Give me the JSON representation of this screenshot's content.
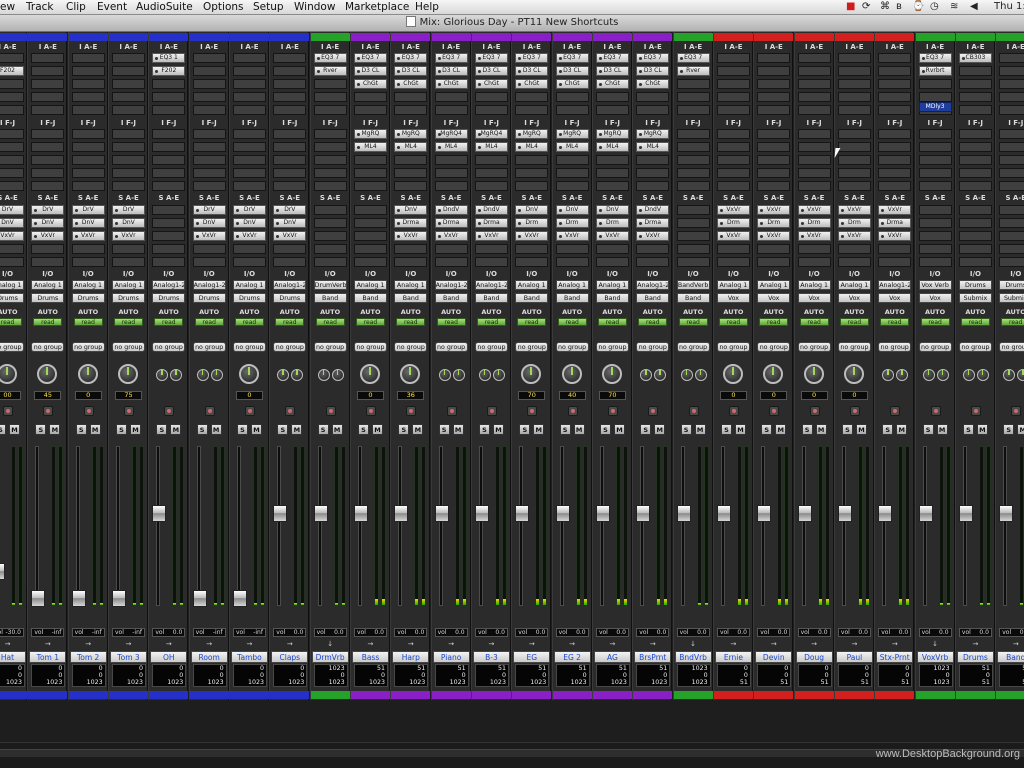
{
  "menubar": {
    "items": [
      "ew",
      "Track",
      "Clip",
      "Event",
      "AudioSuite",
      "Options",
      "Setup",
      "Window",
      "Marketplace",
      "Help"
    ],
    "clock": "Thu 1:"
  },
  "titlebar": {
    "title": "Mix: Glorious Day - PT11 New Shortcuts"
  },
  "section_labels": {
    "inserts_a": "I A-E",
    "inserts_f": "I F-J",
    "sends": "S A-E",
    "io": "I/O",
    "auto": "AUTO",
    "read": "read",
    "vol": "vol"
  },
  "colors": {
    "blue": "#2430c8",
    "green": "#25a22a",
    "purple": "#8a1fc8",
    "red": "#d41f1f",
    "record": "#d06a6a"
  },
  "tracks": [
    {
      "name": "Hat",
      "color": "blue",
      "inserts_a": [
        "",
        "F202"
      ],
      "inserts_f": [],
      "sends": [
        "DrV",
        "DnV",
        "VxVr"
      ],
      "io": [
        "Analog 1",
        "Drums"
      ],
      "pan": "00",
      "vol": "-30.0",
      "fader": 0.22,
      "nums": [
        "0",
        "0",
        "1023"
      ]
    },
    {
      "name": "Tom 1",
      "color": "blue",
      "inserts_a": [],
      "inserts_f": [],
      "sends": [
        "DrV",
        "DnV",
        "VxVr"
      ],
      "io": [
        "Analog 1",
        "Drums"
      ],
      "pan": "45",
      "vol": "-inf",
      "fader": 0.05,
      "nums": [
        "0",
        "0",
        "1023"
      ]
    },
    {
      "name": "Tom 2",
      "color": "blue",
      "inserts_a": [],
      "inserts_f": [],
      "sends": [
        "DrV",
        "DnV",
        "VxVr"
      ],
      "io": [
        "Analog 1",
        "Drums"
      ],
      "pan": "0",
      "vol": "-inf",
      "fader": 0.05,
      "nums": [
        "0",
        "0",
        "1023"
      ]
    },
    {
      "name": "Tom 3",
      "color": "blue",
      "inserts_a": [],
      "inserts_f": [],
      "sends": [
        "DrV",
        "DnV",
        "VxVr"
      ],
      "io": [
        "Analog 1",
        "Drums"
      ],
      "pan": "75",
      "vol": "-inf",
      "fader": 0.05,
      "nums": [
        "0",
        "0",
        "1023"
      ]
    },
    {
      "name": "OH",
      "color": "blue",
      "inserts_a": [
        "EQ3 1",
        "F202"
      ],
      "inserts_f": [],
      "sends": [],
      "io": [
        "Analog1-2",
        "Drums"
      ],
      "pan": "",
      "vol": "0.0",
      "fader": 0.58,
      "nums": [
        "0",
        "0",
        "1023"
      ]
    },
    {
      "name": "Room",
      "color": "blue",
      "inserts_a": [],
      "inserts_f": [],
      "sends": [
        "DrV",
        "DnV",
        "VxVr"
      ],
      "io": [
        "Analog1-2",
        "Drums"
      ],
      "pan": "",
      "vol": "-inf",
      "fader": 0.05,
      "nums": [
        "0",
        "0",
        "1023"
      ]
    },
    {
      "name": "Tambo",
      "color": "blue",
      "inserts_a": [],
      "inserts_f": [],
      "sends": [
        "DrV",
        "DnV",
        "VxVr"
      ],
      "io": [
        "Analog 1",
        "Drums"
      ],
      "pan": "0",
      "vol": "-inf",
      "fader": 0.05,
      "nums": [
        "0",
        "0",
        "1023"
      ]
    },
    {
      "name": "Claps",
      "color": "blue",
      "inserts_a": [],
      "inserts_f": [],
      "sends": [
        "DrV",
        "DnV",
        "VxVr"
      ],
      "io": [
        "Analog1-2",
        "Drums"
      ],
      "pan": "",
      "vol": "0.0",
      "fader": 0.58,
      "nums": [
        "0",
        "0",
        "1023"
      ]
    },
    {
      "name": "DrmVrb",
      "color": "green",
      "inserts_a": [
        "EQ3 7",
        "Rver"
      ],
      "inserts_f": [],
      "sends": [],
      "io": [
        "DrumVerb",
        "Band"
      ],
      "pan": "",
      "vol": "0.0",
      "fader": 0.58,
      "nums": [
        "1023",
        "0",
        "1023"
      ]
    },
    {
      "name": "Bass",
      "color": "purple",
      "inserts_a": [
        "EQ3 7",
        "D3 CL",
        "ChGt"
      ],
      "inserts_f": [
        "MgRQ",
        "ML4"
      ],
      "sends": [],
      "io": [
        "Analog 1",
        "Band"
      ],
      "pan": "0",
      "vol": "0.0",
      "fader": 0.58,
      "nums": [
        "51",
        "0",
        "1023"
      ]
    },
    {
      "name": "Harp",
      "color": "purple",
      "inserts_a": [
        "EQ3 7",
        "D3 CL",
        "ChGt"
      ],
      "inserts_f": [
        "MgRQ",
        "ML4"
      ],
      "sends": [
        "DnV",
        "Drma",
        "VxVr"
      ],
      "io": [
        "Analog 1",
        "Band"
      ],
      "pan": "36",
      "vol": "0.0",
      "fader": 0.58,
      "nums": [
        "51",
        "0",
        "1023"
      ]
    },
    {
      "name": "Piano",
      "color": "purple",
      "inserts_a": [
        "EQ3 7",
        "D3 CL",
        "ChGt"
      ],
      "inserts_f": [
        "MgRQ4",
        "ML4"
      ],
      "sends": [
        "DndV",
        "Drma",
        "VxVr"
      ],
      "io": [
        "Analog1-2",
        "Band"
      ],
      "pan": "",
      "vol": "0.0",
      "fader": 0.58,
      "nums": [
        "51",
        "0",
        "1023"
      ]
    },
    {
      "name": "B-3",
      "color": "purple",
      "inserts_a": [
        "EQ3 7",
        "D3 CL",
        "ChGt"
      ],
      "inserts_f": [
        "MgRQ4",
        "ML4"
      ],
      "sends": [
        "DndV",
        "Drma",
        "VxVr"
      ],
      "io": [
        "Analog1-2",
        "Band"
      ],
      "pan": "",
      "vol": "0.0",
      "fader": 0.58,
      "nums": [
        "51",
        "0",
        "1023"
      ]
    },
    {
      "name": "EG",
      "color": "purple",
      "inserts_a": [
        "EQ3 7",
        "D3 CL",
        "ChGt"
      ],
      "inserts_f": [
        "MgRQ",
        "ML4"
      ],
      "sends": [
        "DnV",
        "Drm",
        "VxVr"
      ],
      "io": [
        "Analog 1",
        "Band"
      ],
      "pan": "70",
      "vol": "0.0",
      "fader": 0.58,
      "nums": [
        "51",
        "0",
        "1023"
      ]
    },
    {
      "name": "EG 2",
      "color": "purple",
      "inserts_a": [
        "EQ3 7",
        "D3 CL",
        "ChGt"
      ],
      "inserts_f": [
        "MgRQ",
        "ML4"
      ],
      "sends": [
        "DnV",
        "Drm",
        "VxVr"
      ],
      "io": [
        "Analog 1",
        "Band"
      ],
      "pan": "40",
      "vol": "0.0",
      "fader": 0.58,
      "nums": [
        "51",
        "0",
        "1023"
      ]
    },
    {
      "name": "AG",
      "color": "purple",
      "inserts_a": [
        "EQ3 7",
        "D3 CL",
        "ChGt"
      ],
      "inserts_f": [
        "MgRQ",
        "ML4"
      ],
      "sends": [
        "DnV",
        "Drm",
        "VxVr"
      ],
      "io": [
        "Analog 1",
        "Band"
      ],
      "pan": "70",
      "vol": "0.0",
      "fader": 0.58,
      "nums": [
        "51",
        "0",
        "1023"
      ]
    },
    {
      "name": "BrsPrnt",
      "color": "purple",
      "inserts_a": [
        "EQ3 7",
        "D3 CL",
        "ChGt"
      ],
      "inserts_f": [
        "MgRQ",
        "ML4"
      ],
      "sends": [
        "DndV",
        "Drma",
        "VxVr"
      ],
      "io": [
        "Analog1-2",
        "Band"
      ],
      "pan": "",
      "vol": "0.0",
      "fader": 0.58,
      "nums": [
        "51",
        "0",
        "1023"
      ]
    },
    {
      "name": "BndVrb",
      "color": "green",
      "inserts_a": [
        "EQ3 7",
        "Rver"
      ],
      "inserts_f": [],
      "sends": [],
      "io": [
        "BandVerb",
        "Band"
      ],
      "pan": "",
      "vol": "0.0",
      "fader": 0.58,
      "nums": [
        "1023",
        "0",
        "1023"
      ]
    },
    {
      "name": "Ernie",
      "color": "red",
      "inserts_a": [],
      "inserts_f": [],
      "sends": [
        "VxVr",
        "Drm",
        "VxVr"
      ],
      "io": [
        "Analog 1",
        "Vox"
      ],
      "pan": "0",
      "vol": "0.0",
      "fader": 0.58,
      "nums": [
        "0",
        "0",
        "51"
      ]
    },
    {
      "name": "Devin",
      "color": "red",
      "inserts_a": [],
      "inserts_f": [],
      "sends": [
        "VxVr",
        "Drm",
        "VxVr"
      ],
      "io": [
        "Analog 1",
        "Vox"
      ],
      "pan": "0",
      "vol": "0.0",
      "fader": 0.58,
      "nums": [
        "0",
        "0",
        "51"
      ]
    },
    {
      "name": "Doug",
      "color": "red",
      "inserts_a": [],
      "inserts_f": [],
      "sends": [
        "VxVr",
        "Drm",
        "VxVr"
      ],
      "io": [
        "Analog 1",
        "Vox"
      ],
      "pan": "0",
      "vol": "0.0",
      "fader": 0.58,
      "nums": [
        "0",
        "0",
        "51"
      ]
    },
    {
      "name": "Paul",
      "color": "red",
      "inserts_a": [],
      "inserts_f": [],
      "sends": [
        "VxVr",
        "Drm",
        "VxVr"
      ],
      "io": [
        "Analog 1",
        "Vox"
      ],
      "pan": "0",
      "vol": "0.0",
      "fader": 0.58,
      "nums": [
        "0",
        "0",
        "51"
      ]
    },
    {
      "name": "Stx-Prnt",
      "color": "red",
      "inserts_a": [],
      "inserts_f": [],
      "sends": [
        "VxVr",
        "Drma",
        "VxVr"
      ],
      "io": [
        "Analog1-2",
        "Vox"
      ],
      "pan": "",
      "vol": "0.0",
      "fader": 0.58,
      "nums": [
        "0",
        "0",
        "51"
      ]
    },
    {
      "name": "VoxVrb",
      "color": "green",
      "inserts_a": [
        "EQ3 7",
        "Rvrbrt"
      ],
      "inserts_f": [],
      "sends": [],
      "io": [
        "Vox Verb",
        "Vox"
      ],
      "pan": "",
      "vol": "0.0",
      "fader": 0.58,
      "nums": [
        "1023",
        "0",
        "1023"
      ],
      "blue_slot": "MDly3"
    },
    {
      "name": "Drums",
      "color": "green",
      "inserts_a": [
        "CB303"
      ],
      "inserts_f": [],
      "sends": [],
      "io": [
        "Drums",
        "Submix"
      ],
      "pan": "",
      "vol": "0.0",
      "fader": 0.58,
      "nums": [
        "51",
        "0",
        "51"
      ]
    },
    {
      "name": "Band",
      "color": "green",
      "inserts_a": [],
      "inserts_f": [],
      "sends": [],
      "io": [
        "Drums",
        "Submix"
      ],
      "pan": "",
      "vol": "0.0",
      "fader": 0.58,
      "nums": [
        "51",
        "0",
        "51"
      ]
    }
  ],
  "footer": {
    "watermark": "www.DesktopBackground.org"
  }
}
